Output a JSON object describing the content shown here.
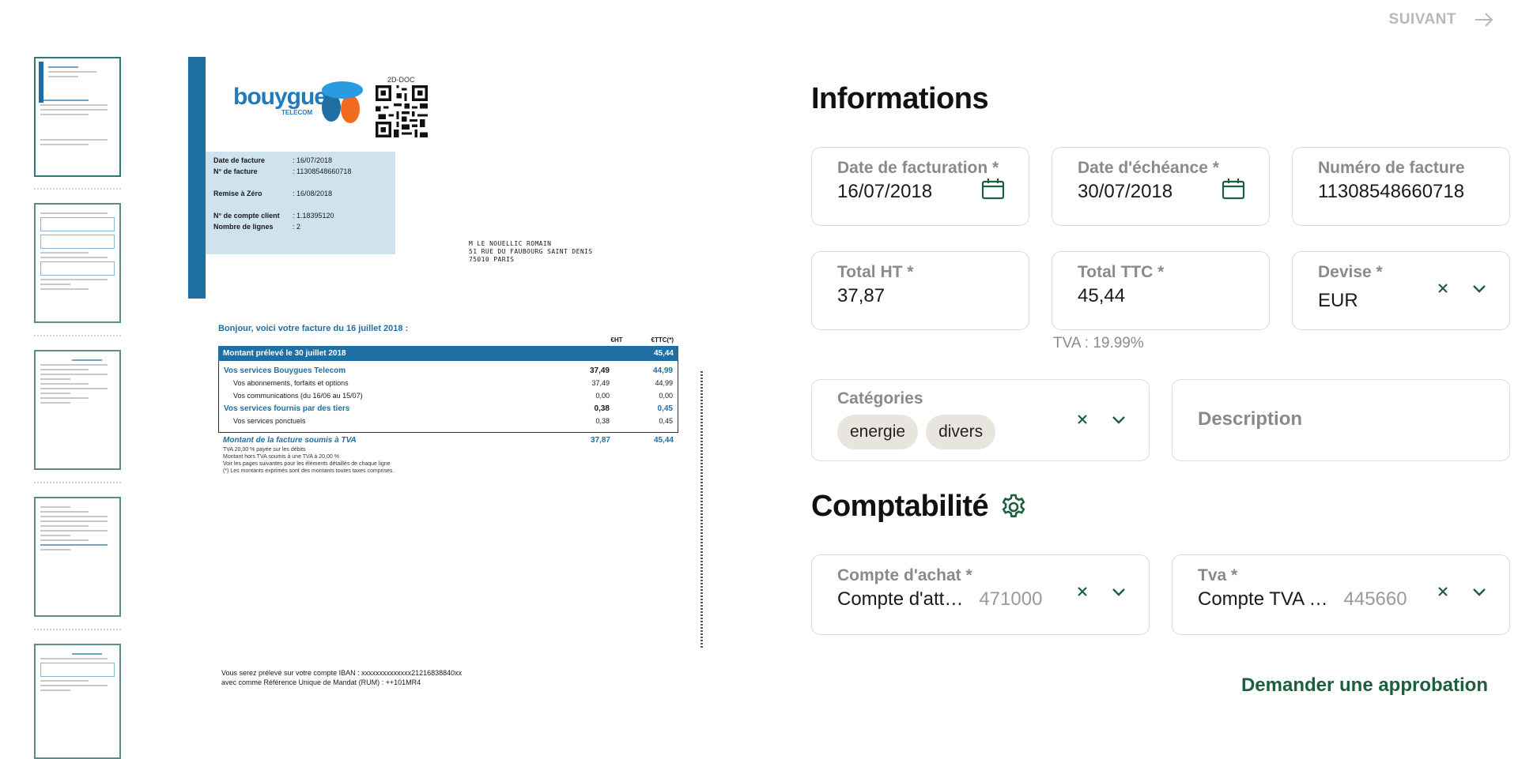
{
  "nav": {
    "next_label": "SUIVANT"
  },
  "invoice": {
    "brand": "bouygues",
    "brand_sub": "TELECOM",
    "code_2d_label": "2D-DOC",
    "info": [
      {
        "label": "Date de facture",
        "value": ": 16/07/2018"
      },
      {
        "label": "N° de facture",
        "value": ": 11308548660718"
      },
      {
        "label": "Remise à Zéro",
        "value": ": 16/08/2018"
      },
      {
        "label": "N° de compte client",
        "value": ": 1.18395120"
      },
      {
        "label": "Nombre de lignes",
        "value": ": 2"
      }
    ],
    "address": [
      "M LE NOUELLIC ROMAIN",
      "51 RUE DU FAUBOURG SAINT DENIS",
      "75010 PARIS"
    ],
    "greeting": "Bonjour, voici votre facture du 16 juillet 2018 :",
    "col_ht": "€HT",
    "col_ttc": "€TTC(*)",
    "band_label": "Montant prélevé le 30 juillet 2018",
    "band_value": "45,44",
    "rows": [
      {
        "label": "Vos services Bouygues Telecom",
        "ht": "37,49",
        "ttc": "44,99"
      },
      {
        "label": "Vos abonnements, forfaits et options",
        "ht": "37,49",
        "ttc": "44,99"
      },
      {
        "label": "Vos communications (du 16/06 au 15/07)",
        "ht": "0,00",
        "ttc": "0,00"
      },
      {
        "label": "Vos services fournis par des tiers",
        "ht": "0,38",
        "ttc": "0,45"
      },
      {
        "label": "Vos services ponctuels",
        "ht": "0,38",
        "ttc": "0,45"
      }
    ],
    "total_label": "Montant de la facture soumis à TVA",
    "total_ht": "37,87",
    "total_ttc": "45,44",
    "fine": [
      "TVA 20,00 % payée sur les débits",
      "Montant hors TVA soumis à une TVA à 20,00 %",
      "Voir les pages suivantes pour les éléments détaillés de chaque ligne",
      "(*) Les montants exprimés sont des montants toutes taxes comprises."
    ],
    "footer": [
      "Vous serez prélevé sur votre compte IBAN : xxxxxxxxxxxxxx21216838840xx",
      "avec comme Référence Unique de Mandat (RUM) : ++101MR4"
    ]
  },
  "informations": {
    "title": "Informations",
    "date_facturation": {
      "label": "Date de facturation *",
      "value": "16/07/2018"
    },
    "date_echeance": {
      "label": "Date d'échéance *",
      "value": "30/07/2018"
    },
    "numero_facture": {
      "label": "Numéro de facture",
      "value": "11308548660718"
    },
    "total_ht": {
      "label": "Total HT *",
      "value": "37,87"
    },
    "total_ttc": {
      "label": "Total TTC *",
      "value": "45,44"
    },
    "devise": {
      "label": "Devise *",
      "value": "EUR"
    },
    "tva_note": "TVA : 19.99%",
    "categories": {
      "label": "Catégories",
      "chips": [
        "energie",
        "divers"
      ]
    },
    "description": {
      "placeholder": "Description"
    }
  },
  "comptabilite": {
    "title": "Comptabilité",
    "compte_achat": {
      "label": "Compte d'achat *",
      "value": "Compte d'att…",
      "code": "471000"
    },
    "tva": {
      "label": "Tva *",
      "value": "Compte TVA …",
      "code": "445660"
    }
  },
  "actions": {
    "approval_label": "Demander une approbation"
  },
  "colors": {
    "accent": "#1d5e3f",
    "brand_blue": "#1f6fa2"
  }
}
